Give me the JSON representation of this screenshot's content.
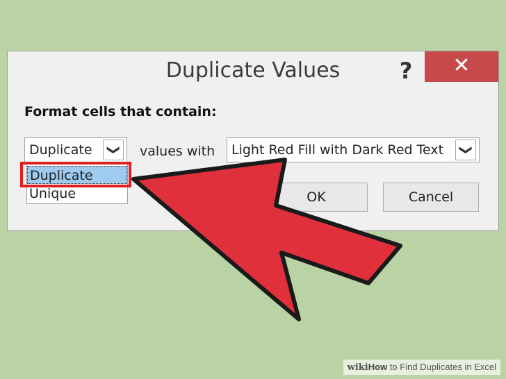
{
  "dialog": {
    "title": "Duplicate Values",
    "help_label": "?",
    "close_label": "✕",
    "prompt": "Format cells that contain:",
    "rule_select": {
      "value": "Duplicate",
      "arrow_glyph": "❯"
    },
    "values_with_label": "values with",
    "format_select": {
      "value": "Light Red Fill with Dark Red Text",
      "arrow_glyph": "❯"
    },
    "dropdown_options": [
      "Duplicate",
      "Unique"
    ],
    "ok_label": "OK",
    "cancel_label": "Cancel"
  },
  "overlay": {
    "arrow_color": "#e0303c",
    "highlight_color": "#e02020"
  },
  "watermark": {
    "wiki": "wiki",
    "how": "How",
    "rest": " to Find Duplicates in Excel"
  }
}
